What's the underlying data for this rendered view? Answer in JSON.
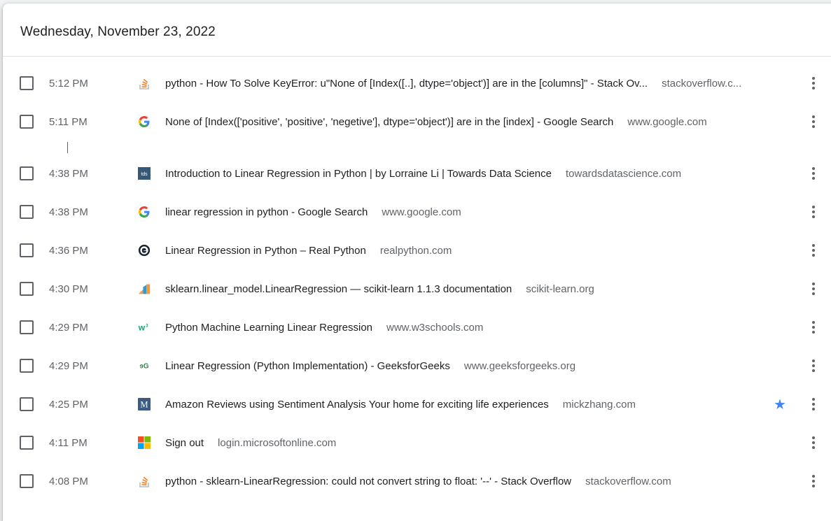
{
  "header": {
    "date": "Wednesday, November 23, 2022"
  },
  "entries": [
    {
      "time": "5:12 PM",
      "icon": "stackoverflow-icon",
      "title": "python - How To Solve KeyError: u\"None of [Index([..], dtype='object')] are in the [columns]\" - Stack Ov...",
      "domain": "stackoverflow.c...",
      "starred": false
    },
    {
      "time": "5:11 PM",
      "icon": "google-icon",
      "title": "None of [Index(['positive', 'positive', 'negetive'], dtype='object')] are in the [index] - Google Search",
      "domain": "www.google.com",
      "starred": false
    },
    {
      "time": "4:38 PM",
      "icon": "tds-icon",
      "title": "Introduction to Linear Regression in Python | by Lorraine Li | Towards Data Science",
      "domain": "towardsdatascience.com",
      "starred": false
    },
    {
      "time": "4:38 PM",
      "icon": "google-icon",
      "title": "linear regression in python - Google Search",
      "domain": "www.google.com",
      "starred": false
    },
    {
      "time": "4:36 PM",
      "icon": "realpython-icon",
      "title": "Linear Regression in Python – Real Python",
      "domain": "realpython.com",
      "starred": false
    },
    {
      "time": "4:30 PM",
      "icon": "scikit-learn-icon",
      "title": "sklearn.linear_model.LinearRegression — scikit-learn 1.1.3 documentation",
      "domain": "scikit-learn.org",
      "starred": false
    },
    {
      "time": "4:29 PM",
      "icon": "w3schools-icon",
      "title": "Python Machine Learning Linear Regression",
      "domain": "www.w3schools.com",
      "starred": false
    },
    {
      "time": "4:29 PM",
      "icon": "geeksforgeeks-icon",
      "title": "Linear Regression (Python Implementation) - GeeksforGeeks",
      "domain": "www.geeksforgeeks.org",
      "starred": false
    },
    {
      "time": "4:25 PM",
      "icon": "medium-m-icon",
      "title": "Amazon Reviews using Sentiment Analysis Your home for exciting life experiences",
      "domain": "mickzhang.com",
      "starred": true
    },
    {
      "time": "4:11 PM",
      "icon": "microsoft-icon",
      "title": "Sign out",
      "domain": "login.microsoftonline.com",
      "starred": false
    },
    {
      "time": "4:08 PM",
      "icon": "stackoverflow-icon",
      "title": "python - sklearn-LinearRegression: could not convert string to float: '--' - Stack Overflow",
      "domain": "stackoverflow.com",
      "starred": false
    }
  ],
  "favicon_labels": {
    "tds": "tds",
    "medium": "M",
    "w3": "w",
    "w3_sup": "3",
    "gfg": "ɘG"
  },
  "colors": {
    "accent": "#4285f4",
    "text": "#202124",
    "secondary": "#5f6368"
  }
}
